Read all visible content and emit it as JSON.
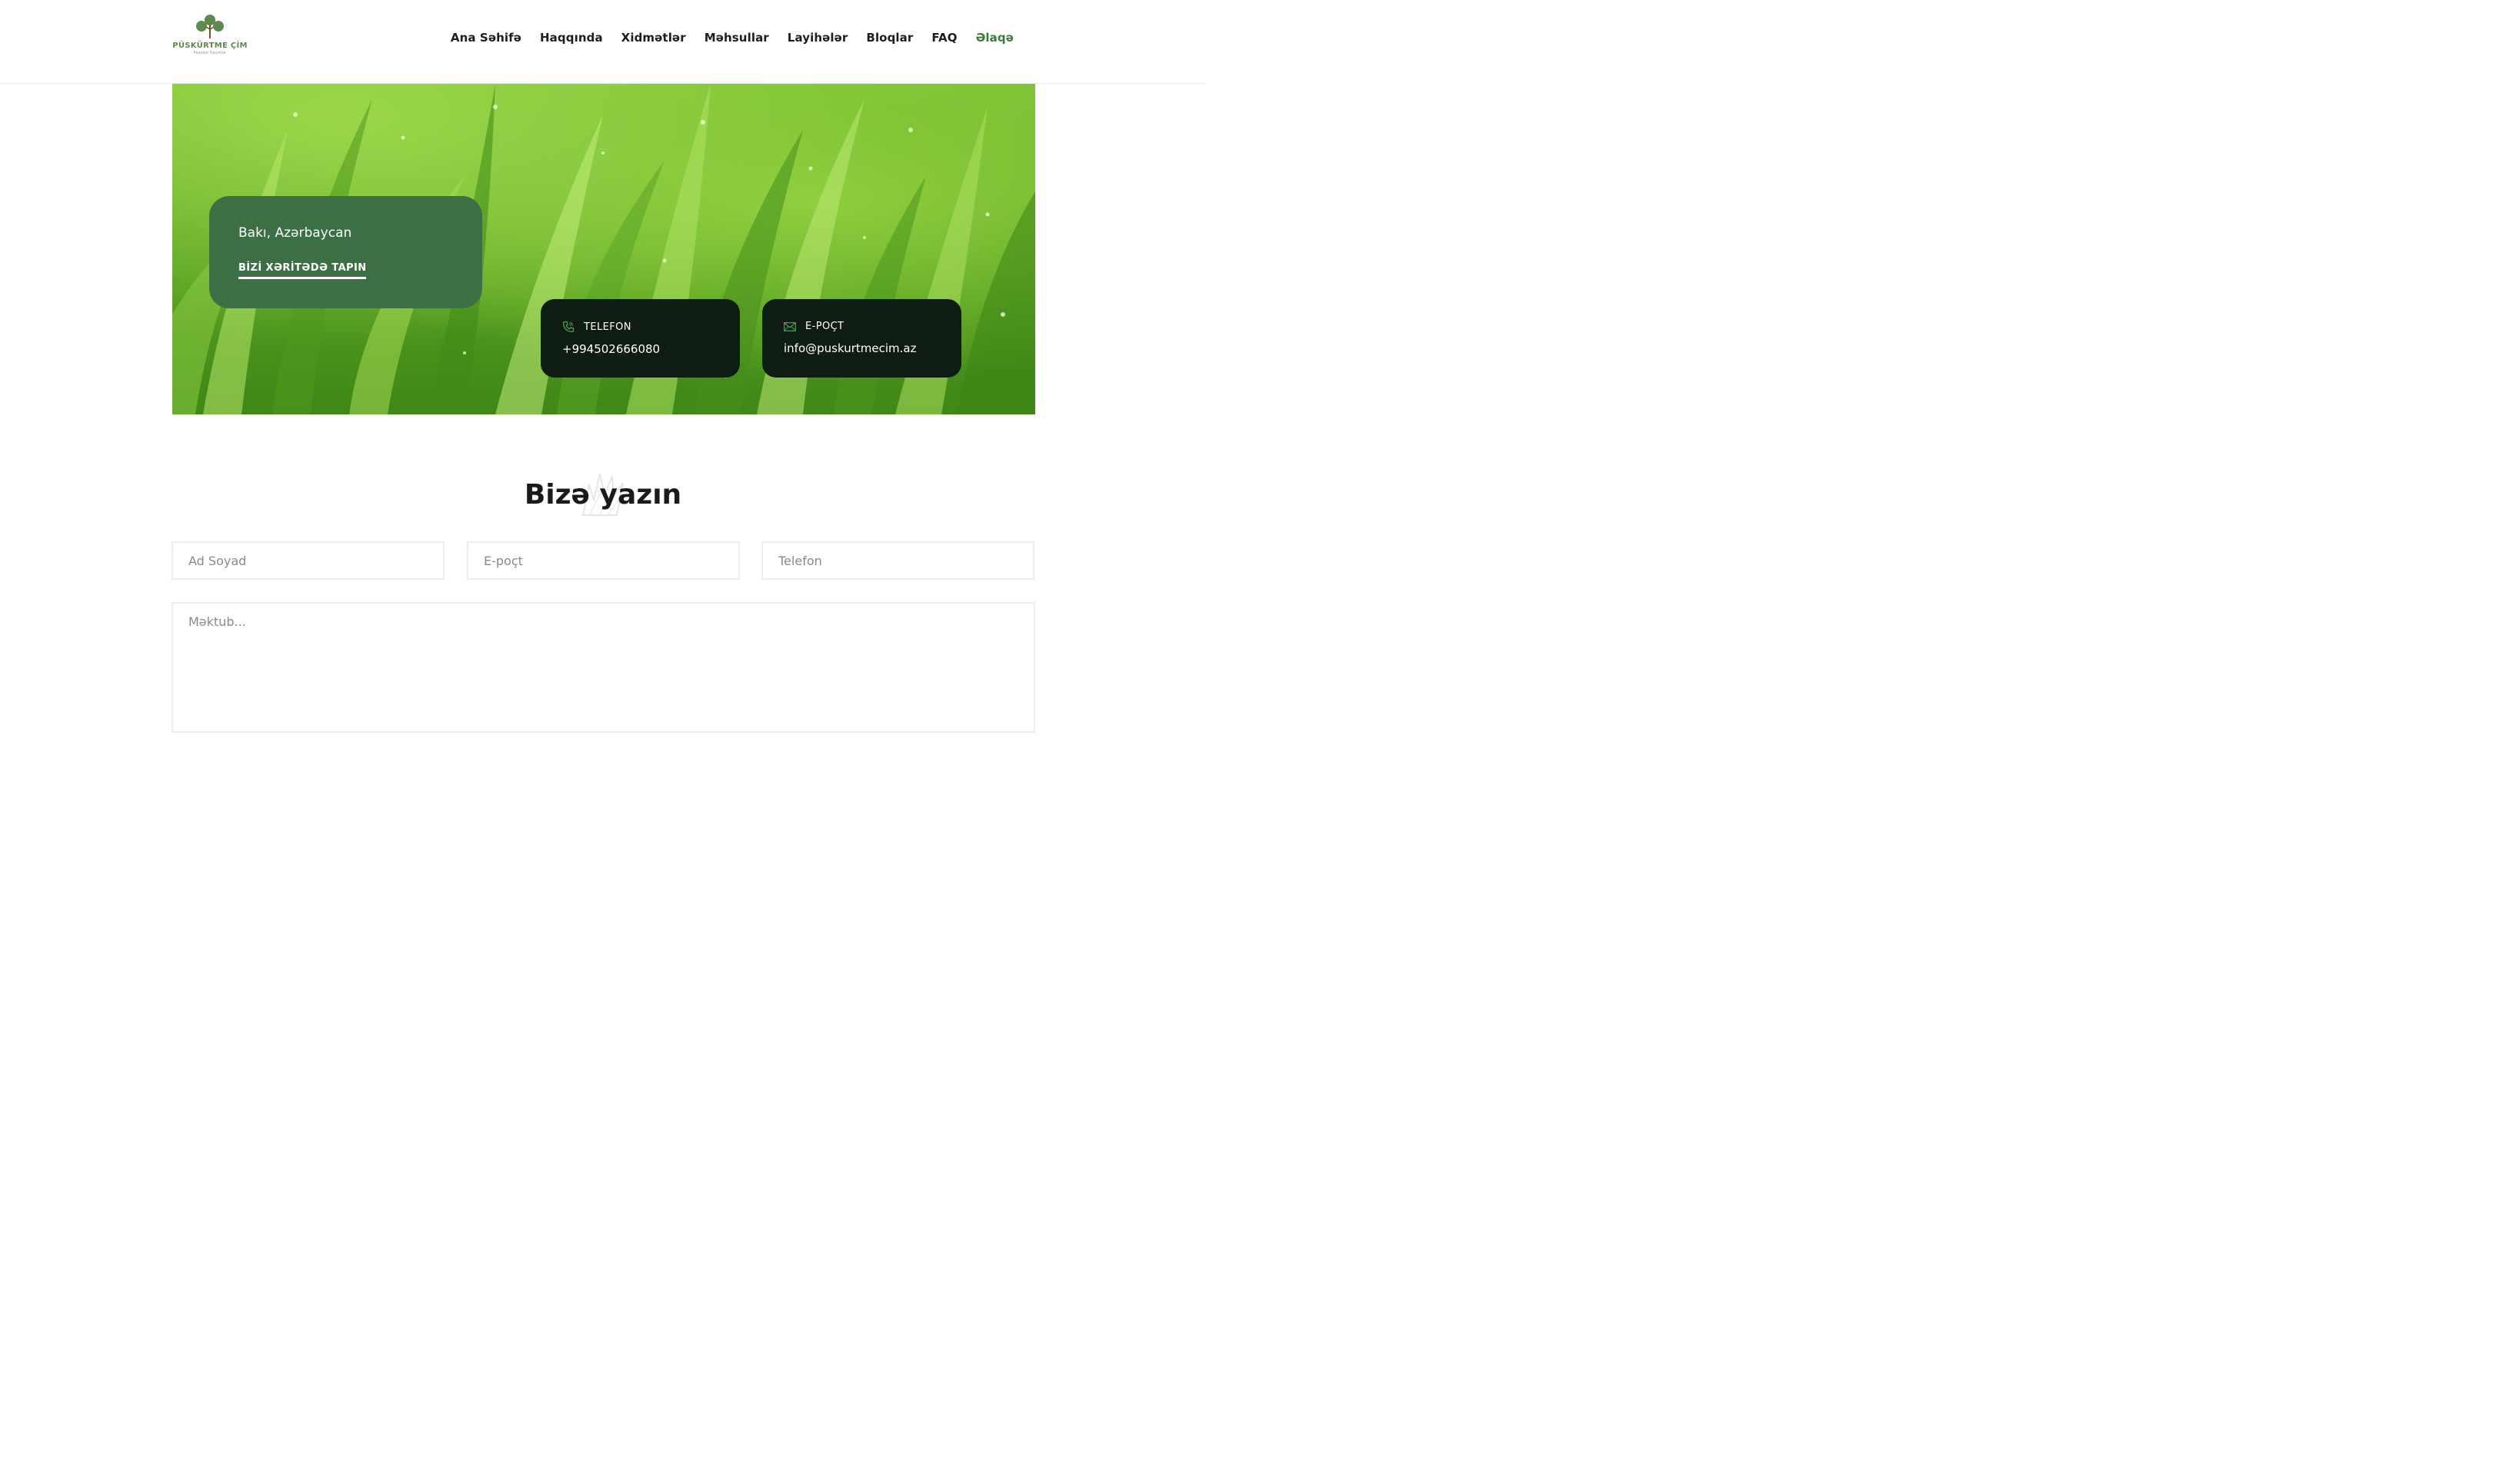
{
  "header": {
    "logo": {
      "text": "PÜSKÜRTME ÇİM",
      "subtext": "Peşəkar Həyətlər"
    },
    "nav": [
      {
        "label": "Ana Səhifə"
      },
      {
        "label": "Haqqında"
      },
      {
        "label": "Xidmətlər"
      },
      {
        "label": "Məhsullar"
      },
      {
        "label": "Layihələr"
      },
      {
        "label": "Bloqlar"
      },
      {
        "label": "FAQ"
      },
      {
        "label": "Əlaqə",
        "active": true
      }
    ]
  },
  "hero": {
    "location": "Bakı, Azərbaycan",
    "map_link": "BİZİ XƏRİTƏDƏ TAPIN",
    "phone": {
      "icon": "phone-icon",
      "label": "TELEFON",
      "value": "+994502666080"
    },
    "email": {
      "icon": "mail-icon",
      "label": "E-POÇT",
      "value": "info@puskurtmecim.az"
    }
  },
  "form": {
    "title": "Bizə yazın",
    "name_placeholder": "Ad Soyad",
    "email_placeholder": "E-poçt",
    "phone_placeholder": "Telefon",
    "message_placeholder": "Məktub..."
  },
  "colors": {
    "accent": "#3b7a3e",
    "location_card": "#3c6f44",
    "info_card": "#0f1c13",
    "nav_text": "#1d1d1d"
  }
}
